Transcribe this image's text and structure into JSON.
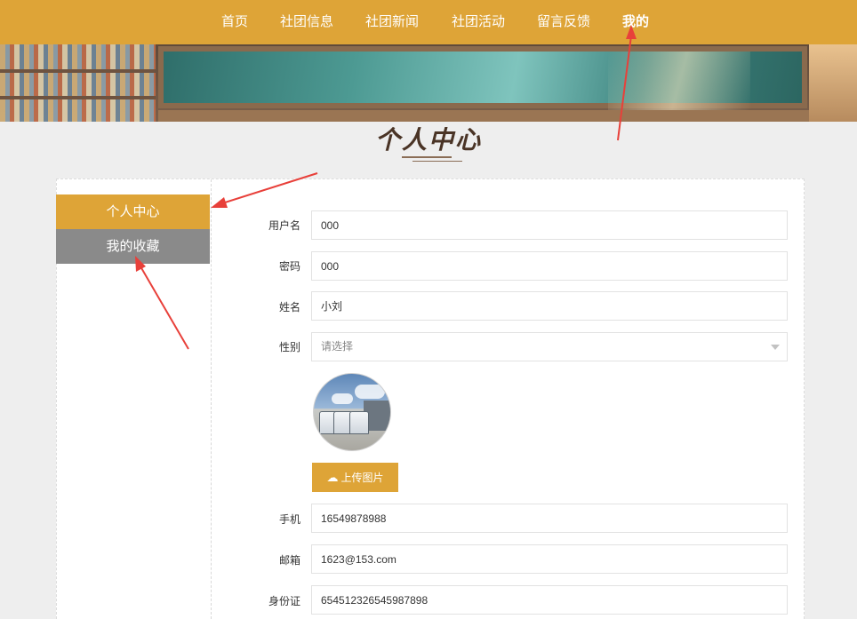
{
  "nav": {
    "items": [
      "首页",
      "社团信息",
      "社团新闻",
      "社团活动",
      "留言反馈",
      "我的"
    ],
    "active_index": 5
  },
  "page_title": "个人中心",
  "sidebar": {
    "items": [
      {
        "label": "个人中心",
        "active": true
      },
      {
        "label": "我的收藏",
        "active": false
      }
    ]
  },
  "form": {
    "username": {
      "label": "用户名",
      "value": "000"
    },
    "password": {
      "label": "密码",
      "value": "000"
    },
    "name": {
      "label": "姓名",
      "value": "小刘"
    },
    "gender": {
      "label": "性别",
      "placeholder": "请选择"
    },
    "upload": {
      "label": "上传图片",
      "icon": "cloud-upload-icon"
    },
    "phone": {
      "label": "手机",
      "value": "16549878988"
    },
    "email": {
      "label": "邮箱",
      "value": "1623@153.com"
    },
    "id_card": {
      "label": "身份证",
      "value": "654512326545987898"
    }
  },
  "colors": {
    "accent": "#dea437",
    "sidebar_inactive": "#8a8a8a",
    "background": "#eeeeee",
    "annotation": "#e8403a"
  }
}
